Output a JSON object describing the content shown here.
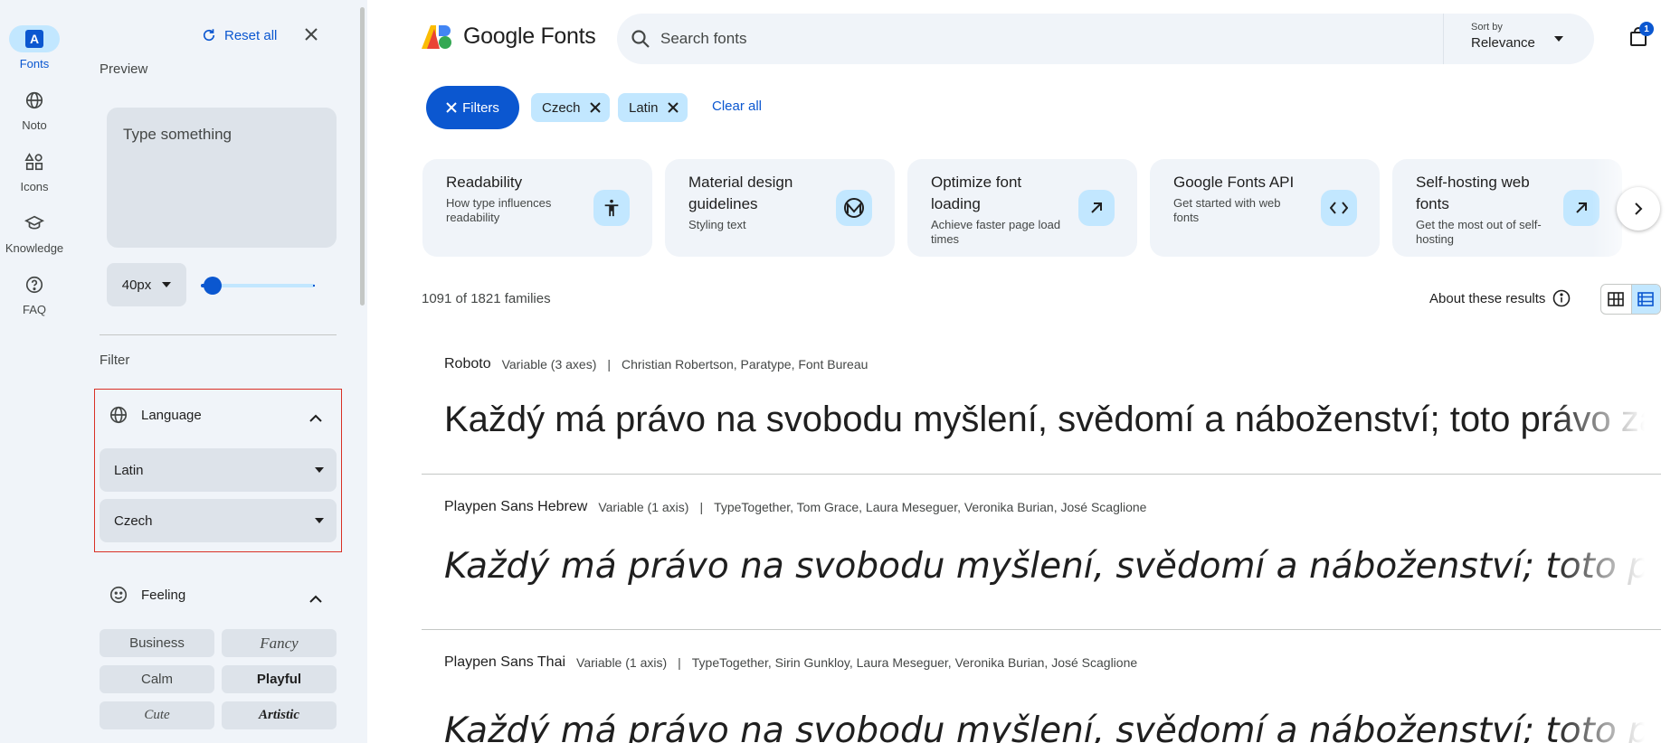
{
  "rail": {
    "items": [
      {
        "label": "Fonts",
        "icon": "fonts-icon"
      },
      {
        "label": "Noto",
        "icon": "globe-icon"
      },
      {
        "label": "Icons",
        "icon": "shapes-icon"
      },
      {
        "label": "Knowledge",
        "icon": "graduation-cap-icon"
      },
      {
        "label": "FAQ",
        "icon": "help-circle-icon"
      }
    ],
    "fonts_letter": "A"
  },
  "panel": {
    "reset_label": "Reset all",
    "preview_title": "Preview",
    "preview_placeholder": "Type something",
    "size_value": "40px",
    "size_slider_fraction": 0.1,
    "filter_title": "Filter",
    "language": {
      "title": "Language",
      "writing_system": "Latin",
      "language": "Czech"
    },
    "feeling": {
      "title": "Feeling",
      "options": [
        "Business",
        "Fancy",
        "Calm",
        "Playful",
        "Cute",
        "Artistic"
      ]
    }
  },
  "header": {
    "logo_text": "Google Fonts",
    "search_placeholder": "Search fonts",
    "sort_label": "Sort by",
    "sort_value": "Relevance",
    "bag_count": "1"
  },
  "filters_bar": {
    "filters_label": "Filters",
    "chips": [
      "Czech",
      "Latin"
    ],
    "clear_all": "Clear all"
  },
  "cards": [
    {
      "title": "Readability",
      "desc": "How type influences readability",
      "icon": "accessibility-icon"
    },
    {
      "title": "Material design guidelines",
      "desc": "Styling text",
      "icon": "material-logo-icon"
    },
    {
      "title": "Optimize font loading",
      "desc": "Achieve faster page load times",
      "icon": "arrow-up-right-icon"
    },
    {
      "title": "Google Fonts API",
      "desc": "Get started with web fonts",
      "icon": "code-icon"
    },
    {
      "title": "Self-hosting web fonts",
      "desc": "Get the most out of self-hosting",
      "icon": "arrow-up-right-icon"
    }
  ],
  "results": {
    "count": "1091 of 1821 families",
    "about": "About these results"
  },
  "families": [
    {
      "name": "Roboto",
      "variable": "Variable (3 axes)",
      "designers": "Christian Robertson, Paratype, Font Bureau",
      "sample": "Každý má právo na svobodu myšlení, svědomí a náboženství; toto právo zahrnuje"
    },
    {
      "name": "Playpen Sans Hebrew",
      "variable": "Variable (1 axis)",
      "designers": "TypeTogether, Tom Grace, Laura Meseguer, Veronika Burian, José Scaglione",
      "sample": "Každý má právo na svobodu myšlení, svědomí a náboženství; toto právo"
    },
    {
      "name": "Playpen Sans Thai",
      "variable": "Variable (1 axis)",
      "designers": "TypeTogether, Sirin Gunkloy, Laura Meseguer, Veronika Burian, José Scaglione",
      "sample": "Každý má právo na svobodu myšlení, svědomí a náboženství; toto právo"
    }
  ],
  "colors": {
    "accent": "#0b57d0",
    "chip": "#c2e7ff",
    "surface": "#f0f4f9",
    "highlight_border": "#d93025"
  }
}
